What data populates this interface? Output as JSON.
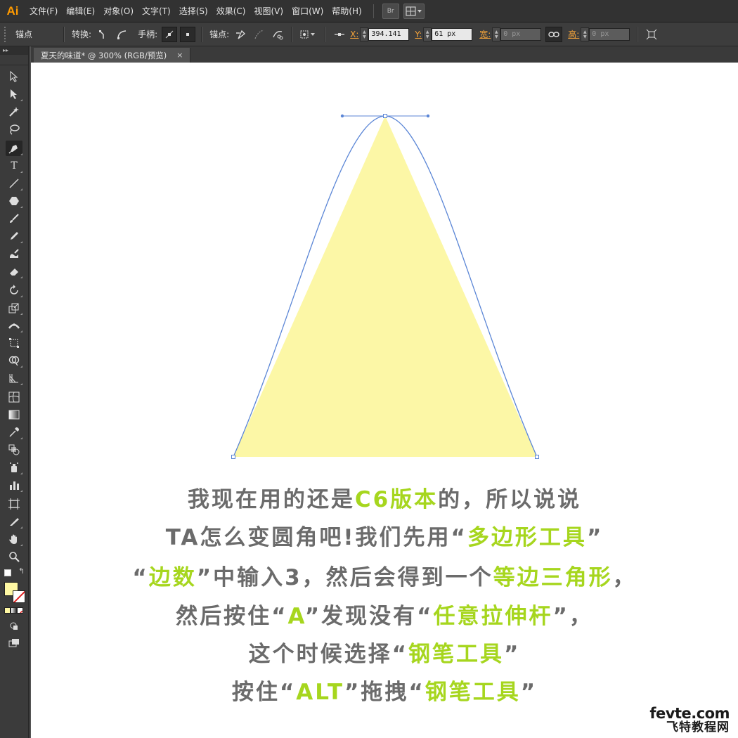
{
  "app": {
    "logo": "Ai"
  },
  "menu": {
    "items": [
      "文件(F)",
      "编辑(E)",
      "对象(O)",
      "文字(T)",
      "选择(S)",
      "效果(C)",
      "视图(V)",
      "窗口(W)",
      "帮助(H)"
    ],
    "bridge_label": "Br"
  },
  "control_bar": {
    "selection_label": "锚点",
    "convert_label": "转换:",
    "handles_label": "手柄:",
    "anchors_label": "锚点:",
    "x_label": "X:",
    "x_value": "394.141",
    "y_label": "Y:",
    "y_value": "61 px",
    "width_label": "宽:",
    "width_value": "0 px",
    "height_label": "高:",
    "height_value": "0 px"
  },
  "document_tab": {
    "title": "夏天的味道* @ 300% (RGB/预览)",
    "close": "×"
  },
  "toolbox": {
    "collapse": "▸▸",
    "tools": [
      "selection-tool",
      "direct-selection-tool",
      "magic-wand-tool",
      "lasso-tool",
      "pen-tool",
      "type-tool",
      "line-segment-tool",
      "polygon-tool",
      "paintbrush-tool",
      "pencil-tool",
      "blob-brush-tool",
      "eraser-tool",
      "rotate-tool",
      "scale-tool",
      "width-tool",
      "free-transform-tool",
      "shape-builder-tool",
      "perspective-grid-tool",
      "mesh-tool",
      "gradient-tool",
      "eyedropper-tool",
      "blend-tool",
      "symbol-sprayer-tool",
      "column-graph-tool",
      "artboard-tool",
      "slice-tool",
      "hand-tool",
      "zoom-tool"
    ],
    "active_tool": "pen-tool",
    "fill_color": "#fff8a3",
    "stroke_color": "none"
  },
  "artwork": {
    "shape": "triangle",
    "fill_color": "#fcf7a6",
    "path_color": "#5b86d6"
  },
  "caption": {
    "line1": {
      "a": "我现在用的还是",
      "b": "C6版本",
      "c": "的，所以说说"
    },
    "line2": {
      "a": "TA怎么变圆角吧!我们先用“",
      "b": "多边形工具",
      "c": "”"
    },
    "line3": {
      "a": "“",
      "b": "边数",
      "c": "”中输入3，然后会得到一个",
      "d": "等边三角形",
      "e": "，"
    },
    "line4": {
      "a": "然后按住“",
      "b": "A",
      "c": "”发现没有“",
      "d": "任意拉伸杆",
      "e": "”，"
    },
    "line5": {
      "a": "这个时候选择“",
      "b": "钢笔工具",
      "c": "”"
    },
    "line6": {
      "a": "按住“",
      "b": "ALT",
      "c": "”拖拽“",
      "d": "钢笔工具",
      "e": "”"
    },
    "text_color": "#6b6b6b",
    "highlight_color": "#a6d61e"
  },
  "watermark": {
    "domain": "fevte.com",
    "name": "飞特教程网"
  }
}
